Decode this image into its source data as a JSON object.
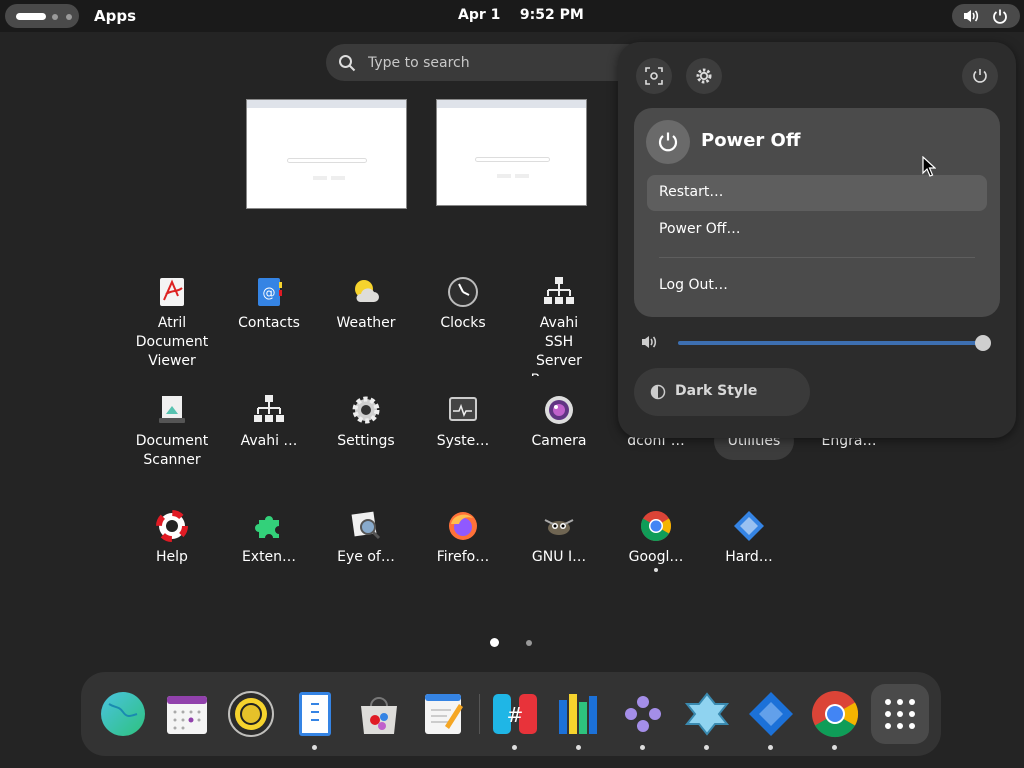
{
  "topbar": {
    "apps_label": "Apps",
    "date": "Apr 1",
    "time": "9:52 PM",
    "status_icons": [
      "volume-icon",
      "power-icon"
    ]
  },
  "search": {
    "placeholder": "Type to search",
    "value": ""
  },
  "windows": [
    {
      "logo": "Google"
    },
    {
      "logo": "Google"
    }
  ],
  "apps": [
    {
      "label": "Atril\nDocument\nViewer",
      "icon": "atril-icon"
    },
    {
      "label": "Contacts",
      "icon": "contacts-icon"
    },
    {
      "label": "Weather",
      "icon": "weather-icon"
    },
    {
      "label": "Clocks",
      "icon": "clocks-icon"
    },
    {
      "label": "Avahi\nSSH\nServer\nBrowser",
      "icon": "network-icon"
    },
    {
      "label": "Document\nScanner",
      "icon": "scanner-icon"
    },
    {
      "label": "Avahi …",
      "icon": "network-icon"
    },
    {
      "label": "Settings",
      "icon": "settings-gear-icon"
    },
    {
      "label": "Syste…",
      "icon": "system-monitor-icon"
    },
    {
      "label": "Camera",
      "icon": "camera-icon"
    },
    {
      "label": "dconf …",
      "icon": "dconf-icon"
    },
    {
      "label": "Utilities",
      "icon": "utilities-folder"
    },
    {
      "label": "Engra…",
      "icon": "engrampa-icon"
    },
    {
      "label": "Help",
      "icon": "help-lifebuoy-icon"
    },
    {
      "label": "Exten…",
      "icon": "extensions-puzzle-icon"
    },
    {
      "label": "Eye of…",
      "icon": "image-viewer-icon"
    },
    {
      "label": "Firefo…",
      "icon": "firefox-icon"
    },
    {
      "label": "GNU I…",
      "icon": "gimp-icon"
    },
    {
      "label": "Googl…",
      "icon": "chrome-icon"
    },
    {
      "label": "Hard…",
      "icon": "hardinfo-icon"
    }
  ],
  "pages": {
    "current": 1,
    "total": 2
  },
  "dock": [
    {
      "name": "globe-browser-icon"
    },
    {
      "name": "calendar-icon"
    },
    {
      "name": "rhythmbox-icon"
    },
    {
      "name": "file-archive-icon"
    },
    {
      "name": "software-store-icon"
    },
    {
      "name": "text-editor-icon"
    },
    {
      "name": "hashtag-app-icon"
    },
    {
      "name": "columns-app-icon"
    },
    {
      "name": "dots-app-icon"
    },
    {
      "name": "gamepad-icon"
    },
    {
      "name": "hardinfo-dock-icon"
    },
    {
      "name": "chrome-dock-icon"
    },
    {
      "name": "show-apps-grid-icon"
    }
  ],
  "quick_settings": {
    "power_menu": {
      "title": "Power Off",
      "items": [
        "Restart…",
        "Power Off…",
        "Log Out…"
      ]
    },
    "volume": {
      "level": 1.0
    },
    "dark_style": {
      "label": "Dark Style"
    }
  },
  "colors": {
    "accent": "#3d6fb1",
    "panel": "#2c2c2c",
    "background": "#242424"
  }
}
